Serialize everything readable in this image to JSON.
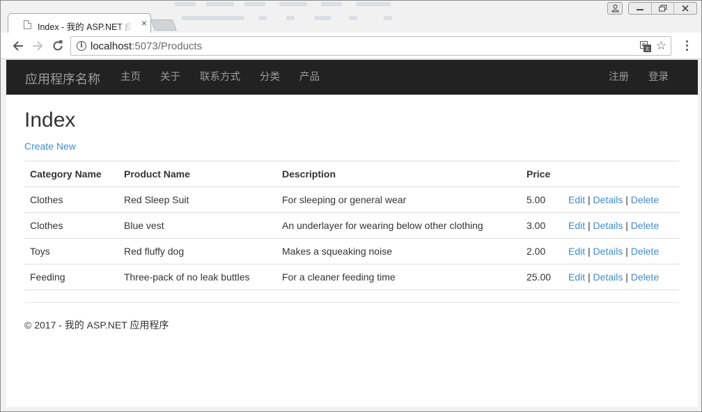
{
  "browser": {
    "tab_title": "Index - 我的 ASP.NET 应用程序",
    "url_host": "localhost",
    "url_path": ":5073/Products"
  },
  "navbar": {
    "brand": "应用程序名称",
    "links": [
      "主页",
      "关于",
      "联系方式",
      "分类",
      "产品"
    ],
    "register": "注册",
    "login": "登录"
  },
  "page": {
    "title": "Index",
    "create_new": "Create New"
  },
  "table": {
    "headers": [
      "Category Name",
      "Product Name",
      "Description",
      "Price",
      ""
    ],
    "rows": [
      {
        "category": "Clothes",
        "product": "Red Sleep Suit",
        "description": "For sleeping or general wear",
        "price": "5.00"
      },
      {
        "category": "Clothes",
        "product": "Blue vest",
        "description": "An underlayer for wearing below other clothing",
        "price": "3.00"
      },
      {
        "category": "Toys",
        "product": "Red fluffy dog",
        "description": "Makes a squeaking noise",
        "price": "2.00"
      },
      {
        "category": "Feeding",
        "product": "Three-pack of no leak buttles",
        "description": "For a cleaner feeding time",
        "price": "25.00"
      }
    ],
    "actions": {
      "edit": "Edit",
      "details": "Details",
      "delete": "Delete",
      "separator": "|"
    }
  },
  "footer": "© 2017 - 我的 ASP.NET 应用程序",
  "colors": {
    "navbar_bg": "#222222",
    "link": "#428bca",
    "nav_text": "#9d9d9d"
  }
}
